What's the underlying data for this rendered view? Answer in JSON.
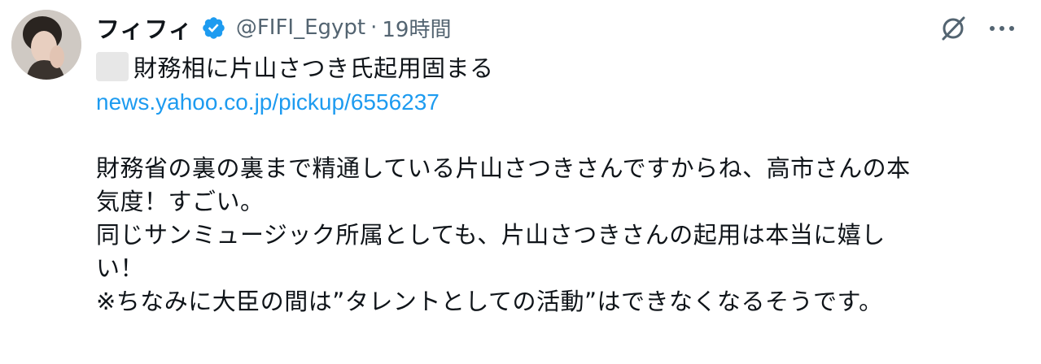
{
  "author": {
    "display_name": "フィフィ",
    "handle": "@FIFI_Egypt",
    "separator": "·",
    "time": "19時間"
  },
  "icons": {
    "avatar": "profile-photo",
    "verified": "verified-badge-icon",
    "grok": "grok-icon",
    "more": "more-icon"
  },
  "colors": {
    "link": "#1d9bf0",
    "verified": "#1d9bf0",
    "secondary_text": "#536471"
  },
  "tweet": {
    "headline": "財務相に片山さつき氏起用固まる",
    "link": "news.yahoo.co.jp/pickup/6556237",
    "lines": [
      "財務省の裏の裏まで精通している片山さつきさんですからね、高市さんの本",
      "気度！すごい。",
      "同じサンミュージック所属としても、片山さつきさんの起用は本当に嬉し",
      "い！",
      "※ちなみに大臣の間は”タレントとしての活動”はできなくなるそうです。"
    ]
  }
}
